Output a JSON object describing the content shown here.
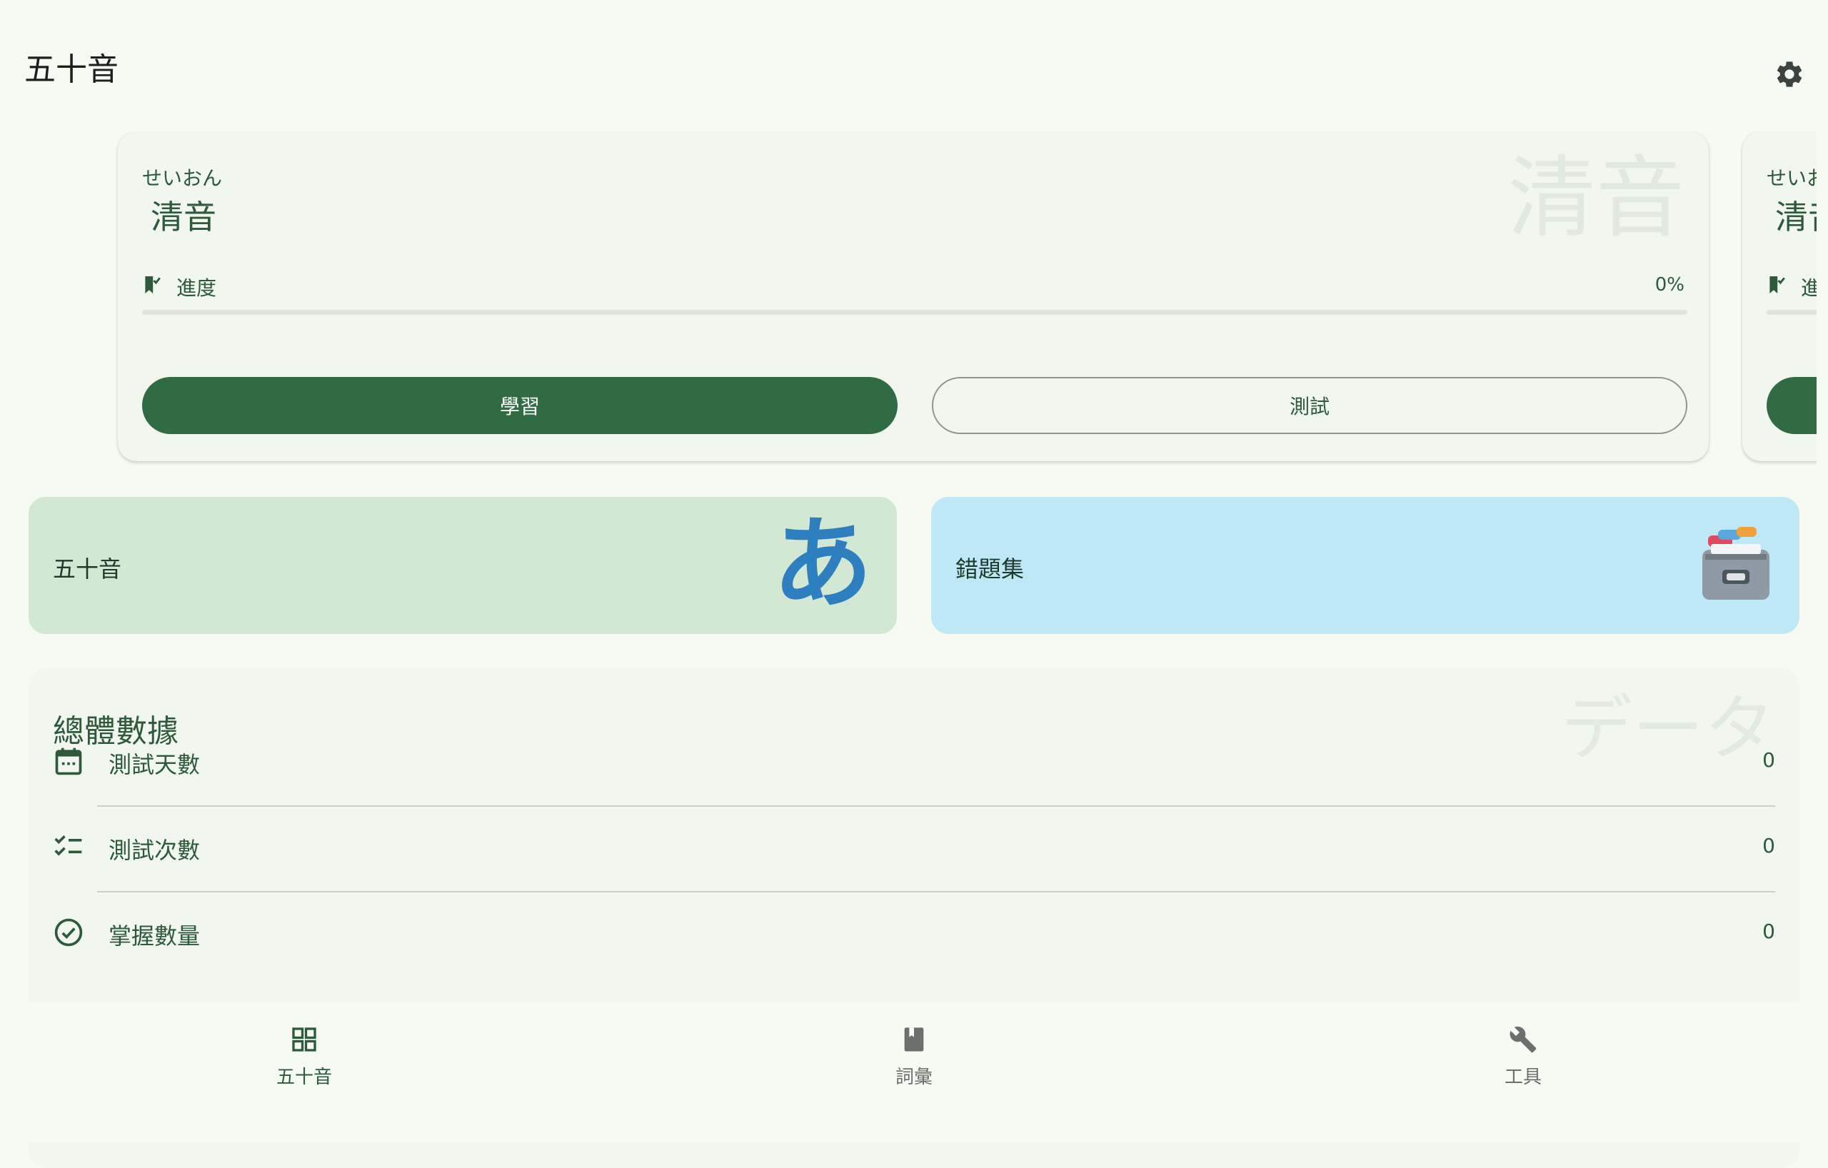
{
  "appbar": {
    "title": "五十音",
    "settings_icon": "gear-icon"
  },
  "carousel": {
    "cards": [
      {
        "kana": "せいおん",
        "title": "清音",
        "watermark": "清音",
        "progress_label": "進度",
        "progress_value": "0%",
        "progress_fraction": 0,
        "study_label": "學習",
        "test_label": "測試"
      },
      {
        "kana": "せいお",
        "title": "清音",
        "progress_label": "進"
      }
    ]
  },
  "tiles": {
    "gojuon": {
      "label": "五十音",
      "glyph": "あ",
      "color": "#d3e8d3"
    },
    "mistakes": {
      "label": "錯題集",
      "icon": "card-file-box-icon",
      "color": "#bee8f6"
    }
  },
  "stats": {
    "title": "總體數據",
    "watermark": "データ",
    "rows": [
      {
        "label": "測試天數",
        "value": "0",
        "icon": "calendar-icon"
      },
      {
        "label": "測試次數",
        "value": "0",
        "icon": "checklist-icon"
      },
      {
        "label": "掌握數量",
        "value": "0",
        "icon": "check-circle-icon"
      }
    ]
  },
  "bottom_nav": {
    "items": [
      {
        "label": "五十音",
        "icon": "grid-icon",
        "active": true
      },
      {
        "label": "詞彙",
        "icon": "book-icon",
        "active": false
      },
      {
        "label": "工具",
        "icon": "wrench-icon",
        "active": false
      }
    ]
  },
  "colors": {
    "accent": "#316b43",
    "background": "#f5faf3",
    "card": "#f1f6ee"
  }
}
